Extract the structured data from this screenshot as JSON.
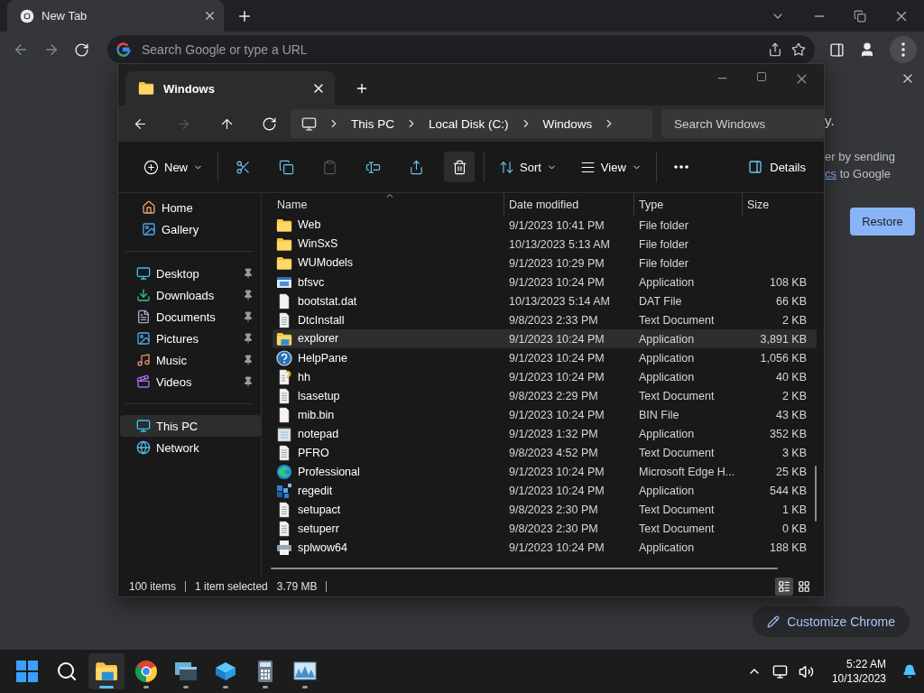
{
  "browser": {
    "tab": {
      "title": "New Tab",
      "selected": true
    },
    "omnibox": {
      "placeholder": "Search Google or type a URL"
    },
    "panel": {
      "heading_fragment": "y.",
      "line_fragment": "er by sending",
      "link_fragment": "cs",
      "line_end": "to Google",
      "restore_button": "Restore"
    },
    "customize_button": "Customize Chrome"
  },
  "explorer": {
    "tab": {
      "title": "Windows"
    },
    "nav": [
      {
        "kind": "back",
        "disabled": false
      },
      {
        "kind": "forward",
        "disabled": true
      },
      {
        "kind": "up",
        "disabled": false
      },
      {
        "kind": "refresh",
        "disabled": false
      }
    ],
    "breadcrumb": [
      "This PC",
      "Local Disk (C:)",
      "Windows"
    ],
    "search": {
      "placeholder": "Search Windows"
    },
    "command_groups": [
      [
        {
          "kind": "new",
          "label": "New",
          "dropdown": true,
          "disabled": false,
          "hovered": false
        }
      ],
      [
        {
          "kind": "cut",
          "disabled": false,
          "hovered": false
        },
        {
          "kind": "copy",
          "disabled": false,
          "hovered": false
        },
        {
          "kind": "paste",
          "disabled": true,
          "hovered": false
        },
        {
          "kind": "rename",
          "disabled": false,
          "hovered": false
        },
        {
          "kind": "share",
          "disabled": false,
          "hovered": false
        },
        {
          "kind": "delete",
          "disabled": false,
          "hovered": true
        }
      ],
      [
        {
          "kind": "sort",
          "label": "Sort",
          "dropdown": true,
          "disabled": false,
          "hovered": false
        },
        {
          "kind": "view",
          "label": "View",
          "dropdown": true,
          "disabled": false,
          "hovered": false
        }
      ],
      [
        {
          "kind": "more",
          "disabled": false,
          "hovered": false
        }
      ]
    ],
    "details_button": "Details",
    "sidebar": [
      [
        {
          "kind": "home",
          "label": "Home",
          "pinned": false,
          "selected": false
        },
        {
          "kind": "gallery",
          "label": "Gallery",
          "pinned": false,
          "selected": false
        }
      ],
      [
        {
          "kind": "desktop",
          "label": "Desktop",
          "pinned": true,
          "selected": false
        },
        {
          "kind": "downloads",
          "label": "Downloads",
          "pinned": true,
          "selected": false
        },
        {
          "kind": "documents",
          "label": "Documents",
          "pinned": true,
          "selected": false
        },
        {
          "kind": "pictures",
          "label": "Pictures",
          "pinned": true,
          "selected": false
        },
        {
          "kind": "music",
          "label": "Music",
          "pinned": true,
          "selected": false
        },
        {
          "kind": "videos",
          "label": "Videos",
          "pinned": true,
          "selected": false
        }
      ],
      [
        {
          "kind": "pc",
          "label": "This PC",
          "pinned": false,
          "selected": true
        },
        {
          "kind": "network",
          "label": "Network",
          "pinned": false,
          "selected": false
        }
      ]
    ],
    "columns": [
      "Name",
      "Date modified",
      "Type",
      "Size"
    ],
    "files": [
      {
        "kind": "folder",
        "name": "Web",
        "date": "9/1/2023 10:41 PM",
        "type": "File folder",
        "selected": false
      },
      {
        "kind": "folder",
        "name": "WinSxS",
        "date": "10/13/2023 5:13 AM",
        "type": "File folder",
        "selected": false
      },
      {
        "kind": "folder",
        "name": "WUModels",
        "date": "9/1/2023 10:29 PM",
        "type": "File folder",
        "selected": false
      },
      {
        "kind": "window",
        "name": "bfsvc",
        "date": "9/1/2023 10:24 PM",
        "type": "Application",
        "size": "108 KB",
        "selected": false
      },
      {
        "kind": "blank",
        "name": "bootstat.dat",
        "date": "10/13/2023 5:14 AM",
        "type": "DAT File",
        "size": "66 KB",
        "selected": false
      },
      {
        "kind": "text",
        "name": "DtcInstall",
        "date": "9/8/2023 2:33 PM",
        "type": "Text Document",
        "size": "2 KB",
        "selected": false
      },
      {
        "kind": "explorer",
        "name": "explorer",
        "date": "9/1/2023 10:24 PM",
        "type": "Application",
        "size": "3,891 KB",
        "selected": true
      },
      {
        "kind": "help",
        "name": "HelpPane",
        "date": "9/1/2023 10:24 PM",
        "type": "Application",
        "size": "1,056 KB",
        "selected": false
      },
      {
        "kind": "hh",
        "name": "hh",
        "date": "9/1/2023 10:24 PM",
        "type": "Application",
        "size": "40 KB",
        "selected": false
      },
      {
        "kind": "text",
        "name": "lsasetup",
        "date": "9/8/2023 2:29 PM",
        "type": "Text Document",
        "size": "2 KB",
        "selected": false
      },
      {
        "kind": "blank",
        "name": "mib.bin",
        "date": "9/1/2023 10:24 PM",
        "type": "BIN File",
        "size": "43 KB",
        "selected": false
      },
      {
        "kind": "notepad",
        "name": "notepad",
        "date": "9/1/2023 1:32 PM",
        "type": "Application",
        "size": "352 KB",
        "selected": false
      },
      {
        "kind": "text",
        "name": "PFRO",
        "date": "9/8/2023 4:52 PM",
        "type": "Text Document",
        "size": "3 KB",
        "selected": false
      },
      {
        "kind": "edge",
        "name": "Professional",
        "date": "9/1/2023 10:24 PM",
        "type": "Microsoft Edge H...",
        "size": "25 KB",
        "selected": false
      },
      {
        "kind": "regedit",
        "name": "regedit",
        "date": "9/1/2023 10:24 PM",
        "type": "Application",
        "size": "544 KB",
        "selected": false
      },
      {
        "kind": "text",
        "name": "setupact",
        "date": "9/8/2023 2:30 PM",
        "type": "Text Document",
        "size": "1 KB",
        "selected": false
      },
      {
        "kind": "text",
        "name": "setuperr",
        "date": "9/8/2023 2:30 PM",
        "type": "Text Document",
        "size": "0 KB",
        "selected": false
      },
      {
        "kind": "printer",
        "name": "splwow64",
        "date": "9/1/2023 10:24 PM",
        "type": "Application",
        "size": "188 KB",
        "selected": false
      }
    ],
    "status": {
      "count": "100 items",
      "selection": "1 item selected",
      "size": "3.79 MB"
    },
    "view_modes": [
      {
        "kind": "details",
        "selected": true
      },
      {
        "kind": "tiles",
        "selected": false
      }
    ]
  },
  "taskbar": {
    "apps": [
      {
        "kind": "start",
        "running": false,
        "selected": false
      },
      {
        "kind": "search",
        "running": false,
        "selected": false
      },
      {
        "kind": "explorer",
        "running": true,
        "selected": true
      },
      {
        "kind": "chrome",
        "running": true,
        "selected": false
      },
      {
        "kind": "remote",
        "running": true,
        "selected": false
      },
      {
        "kind": "box",
        "running": true,
        "selected": false
      },
      {
        "kind": "calculator",
        "running": true,
        "selected": false
      },
      {
        "kind": "monitor",
        "running": true,
        "selected": false
      }
    ],
    "clock": {
      "time": "5:22 AM",
      "date": "10/13/2023"
    }
  }
}
